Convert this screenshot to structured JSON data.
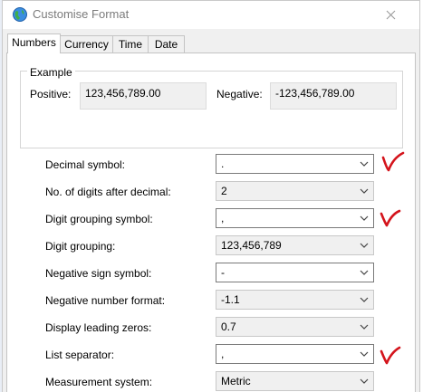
{
  "window": {
    "title": "Customise Format"
  },
  "tabs": [
    {
      "label": "Numbers",
      "active": true
    },
    {
      "label": "Currency",
      "active": false
    },
    {
      "label": "Time",
      "active": false
    },
    {
      "label": "Date",
      "active": false
    }
  ],
  "example": {
    "heading": "Example",
    "positive_label": "Positive:",
    "positive_value": "123,456,789.00",
    "negative_label": "Negative:",
    "negative_value": "-123,456,789.00"
  },
  "settings": [
    {
      "label": "Decimal symbol:",
      "value": ".",
      "marked": true
    },
    {
      "label": "No. of digits after decimal:",
      "value": "2",
      "marked": false
    },
    {
      "label": "Digit grouping symbol:",
      "value": ",",
      "marked": true
    },
    {
      "label": "Digit grouping:",
      "value": "123,456,789",
      "marked": false
    },
    {
      "label": "Negative sign symbol:",
      "value": "-",
      "marked": false
    },
    {
      "label": "Negative number format:",
      "value": "-1.1",
      "marked": false
    },
    {
      "label": "Display leading zeros:",
      "value": "0.7",
      "marked": false
    },
    {
      "label": "List separator:",
      "value": ",",
      "marked": true
    },
    {
      "label": "Measurement system:",
      "value": "Metric",
      "marked": false
    }
  ],
  "colors": {
    "check_mark": "#d4141c",
    "title_text": "#7b7b7b",
    "dialog_bg": "#f0f0f0"
  },
  "icons": {
    "app": "globe-icon",
    "close": "close-icon",
    "dropdown": "chevron-down-icon",
    "annotation": "check-mark-icon"
  }
}
